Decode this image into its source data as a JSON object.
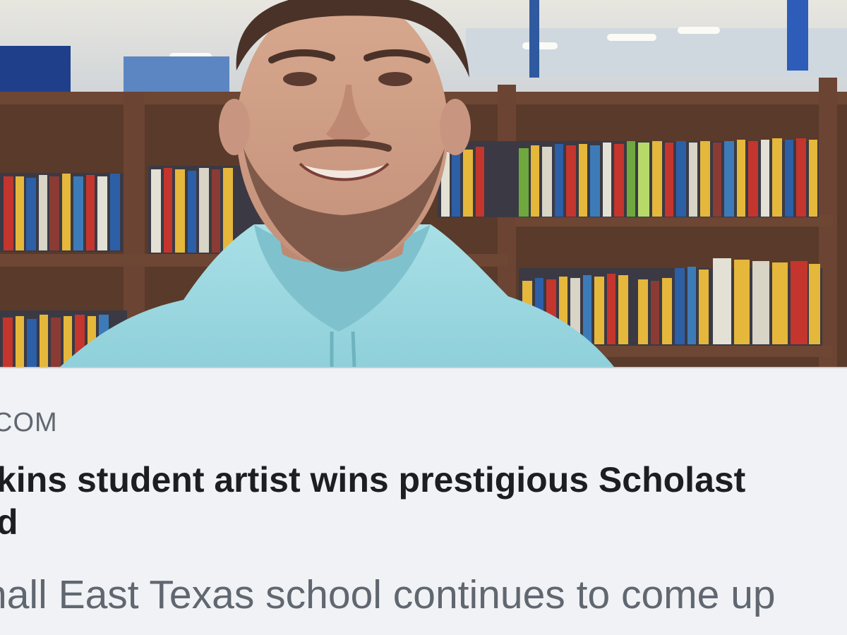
{
  "link_preview": {
    "image_alt": "Student smiling in a library wearing a light blue hoodie",
    "source_domain": "COM",
    "headline_line_1": "kins student artist wins prestigious Scholast",
    "headline_line_2": "d",
    "description": "nall East Texas school continues to come up"
  },
  "colors": {
    "background": "#f0f2f5",
    "domain_text": "#606770",
    "headline_text": "#1c1e21",
    "description_text": "#606770"
  }
}
